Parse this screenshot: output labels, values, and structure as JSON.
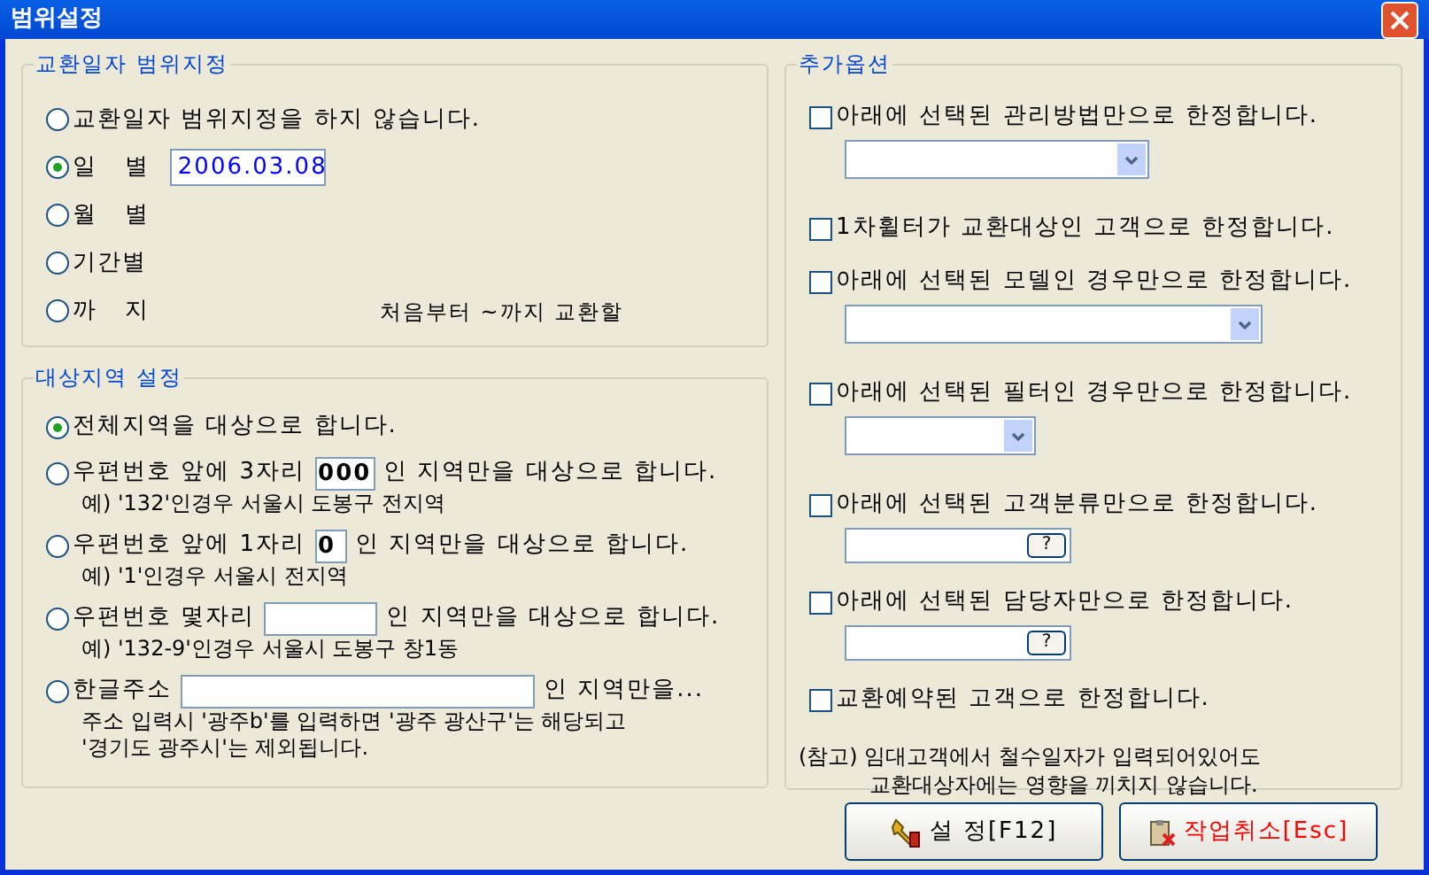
{
  "window": {
    "title": "범위설정"
  },
  "date_range": {
    "title": "교환일자 범위지정",
    "options": [
      {
        "label": "교환일자 범위지정을 하지 않습니다.",
        "selected": false
      },
      {
        "label": "일   별",
        "selected": true,
        "value": "2006.03.08"
      },
      {
        "label": "월   별",
        "selected": false
      },
      {
        "label": "기간별",
        "selected": false
      },
      {
        "label": "까   지",
        "selected": false,
        "note": "처음부터 ~까지 교환할"
      }
    ]
  },
  "region": {
    "title": "대상지역 설정",
    "options": [
      {
        "label": "전체지역을 대상으로 합니다.",
        "selected": true
      },
      {
        "label": "우편번호 앞에 3자리",
        "selected": false,
        "kind": "code3",
        "value": "000",
        "suffix": "인 지역만을 대상으로 합니다.",
        "example": [
          "예) '132'인경우 서울시 도봉구 전지역"
        ]
      },
      {
        "label": "우편번호 앞에 1자리",
        "selected": false,
        "kind": "code1",
        "value": "0",
        "suffix": "인 지역만을 대상으로 합니다.",
        "example": [
          "예) '1'인경우 서울시 전지역"
        ]
      },
      {
        "label": "우편번호 몇자리",
        "selected": false,
        "kind": "code",
        "suffix": "인 지역만을 대상으로 합니다.",
        "example": [
          "예) '132-9'인경우 서울시 도봉구 창1동"
        ]
      },
      {
        "label": "한글주소",
        "selected": false,
        "kind": "address",
        "suffix": "인 지역만을...",
        "example": [
          "주소 입력시 '광주b'를 입력하면 '광주 광산구'는 해당되고",
          "'경기도 광주시'는 제외됩니다."
        ]
      }
    ]
  },
  "extra": {
    "title": "추가옵션",
    "options": [
      {
        "label": "아래에 선택된 관리방법만으로 한정합니다.",
        "checked": false,
        "kind": "dropdown_medium"
      },
      {
        "label": "1차휠터가 교환대상인 고객으로 한정합니다.",
        "checked": false
      },
      {
        "label": "아래에 선택된 모델인 경우만으로 한정합니다.",
        "checked": false,
        "kind": "dropdown_wide"
      },
      {
        "label": "아래에 선택된 필터인 경우만으로 한정합니다.",
        "checked": false,
        "kind": "dropdown_narrow"
      },
      {
        "label": "아래에 선택된 고객분류만으로 한정합니다.",
        "checked": false,
        "kind": "lookup",
        "button": "?"
      },
      {
        "label": "아래에 선택된 담당자만으로 한정합니다.",
        "checked": false,
        "kind": "lookup",
        "button": "?"
      },
      {
        "label": "교환예약된 고객으로 한정합니다.",
        "checked": false
      }
    ],
    "note": [
      "(참고) 임대고객에서 철수일자가 입력되어있어도",
      "교환대상자에는 영향을 끼치지 않습니다."
    ]
  },
  "buttons": [
    {
      "label": "설 정[F12]",
      "kind": "confirm"
    },
    {
      "label": "작업취소[Esc]",
      "kind": "cancel"
    }
  ]
}
